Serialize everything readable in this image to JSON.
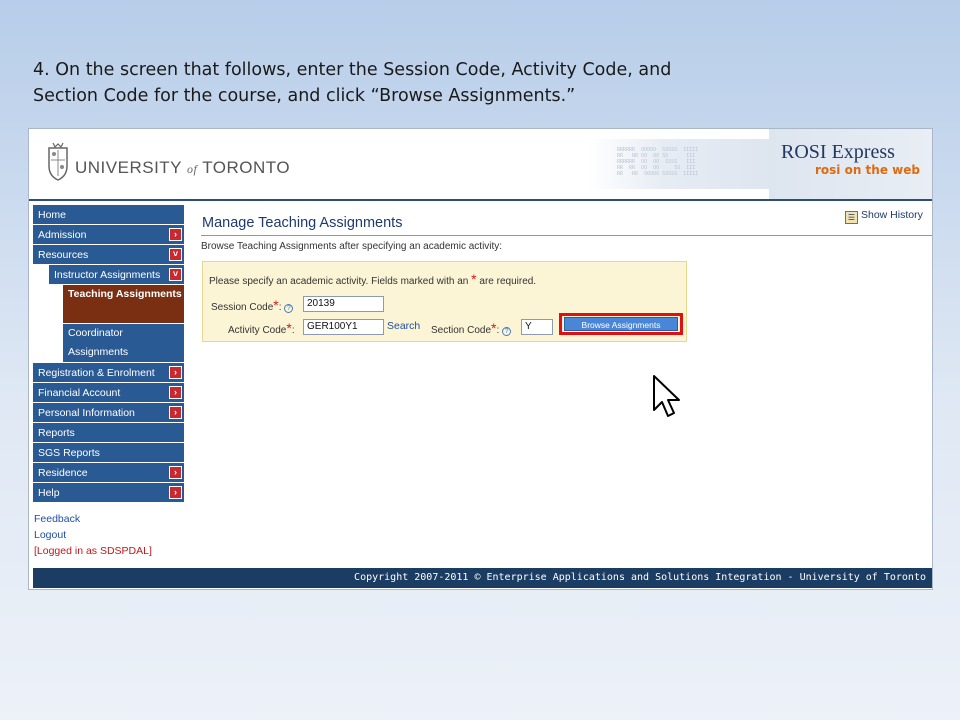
{
  "slide": {
    "title_line1": "4. On the screen that follows, enter the Session Code, Activity Code, and",
    "title_line2": "Section Code for the course, and click “Browse Assignments.”"
  },
  "header": {
    "university": "UNIVERSITY",
    "of": "of",
    "toronto": "TORONTO",
    "app_title": "ROSI Express",
    "app_subtitle": "rosi on the web"
  },
  "sidebar": {
    "items": [
      {
        "label": "Home",
        "arrow": ""
      },
      {
        "label": "Admission",
        "arrow": "›"
      },
      {
        "label": "Resources",
        "arrow": "˅"
      },
      {
        "label": "Instructor Assignments",
        "arrow": "˅"
      },
      {
        "label": "Teaching Assignments",
        "arrow": ""
      },
      {
        "label": "Coordinator Assignments",
        "arrow": ""
      },
      {
        "label": "Registration & Enrolment",
        "arrow": "›"
      },
      {
        "label": "Financial Account",
        "arrow": "›"
      },
      {
        "label": "Personal Information",
        "arrow": "›"
      },
      {
        "label": "Reports",
        "arrow": ""
      },
      {
        "label": "SGS Reports",
        "arrow": ""
      },
      {
        "label": "Residence",
        "arrow": "›"
      },
      {
        "label": "Help",
        "arrow": "›"
      }
    ],
    "feedback": "Feedback",
    "logout": "Logout",
    "logged_in": "[Logged in as SDSPDAL]"
  },
  "main": {
    "page_title": "Manage Teaching Assignments",
    "show_history": "Show History",
    "browse_description": "Browse Teaching Assignments after specifying an academic activity:",
    "form": {
      "instructions_pre": "Please specify an academic activity. Fields marked with an",
      "required_marker": "*",
      "instructions_post": "are required.",
      "session_label": "Session Code",
      "session_value": "20139",
      "activity_label": "Activity Code",
      "activity_value": "GER100Y1",
      "search_link": "Search",
      "section_label": "Section Code",
      "section_value": "Y",
      "browse_button": "Browse Assignments"
    }
  },
  "footer": {
    "copyright": "Copyright 2007-2011 © Enterprise Applications and Solutions Integration - University of Toronto"
  },
  "colors": {
    "nav_blue": "#2a5a94",
    "nav_active": "#7a2e12",
    "highlight_red": "#e01010",
    "footer_navy": "#1c3d63"
  }
}
